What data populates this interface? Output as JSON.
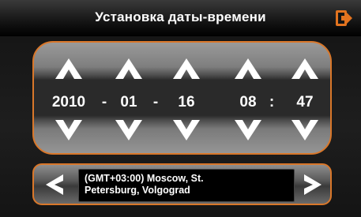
{
  "header": {
    "title": "Установка даты-времени",
    "exit_icon": "exit-icon"
  },
  "datetime": {
    "year": "2010",
    "month": "01",
    "day": "16",
    "hour": "08",
    "minute": "47",
    "date_separator": "-",
    "time_separator": ":"
  },
  "timezone": {
    "line1": "(GMT+03:00) Moscow, St.",
    "line2": "Petersburg, Volgograd"
  },
  "colors": {
    "accent": "#d9772a",
    "background": "#1a1a1a",
    "text": "#ffffff"
  }
}
